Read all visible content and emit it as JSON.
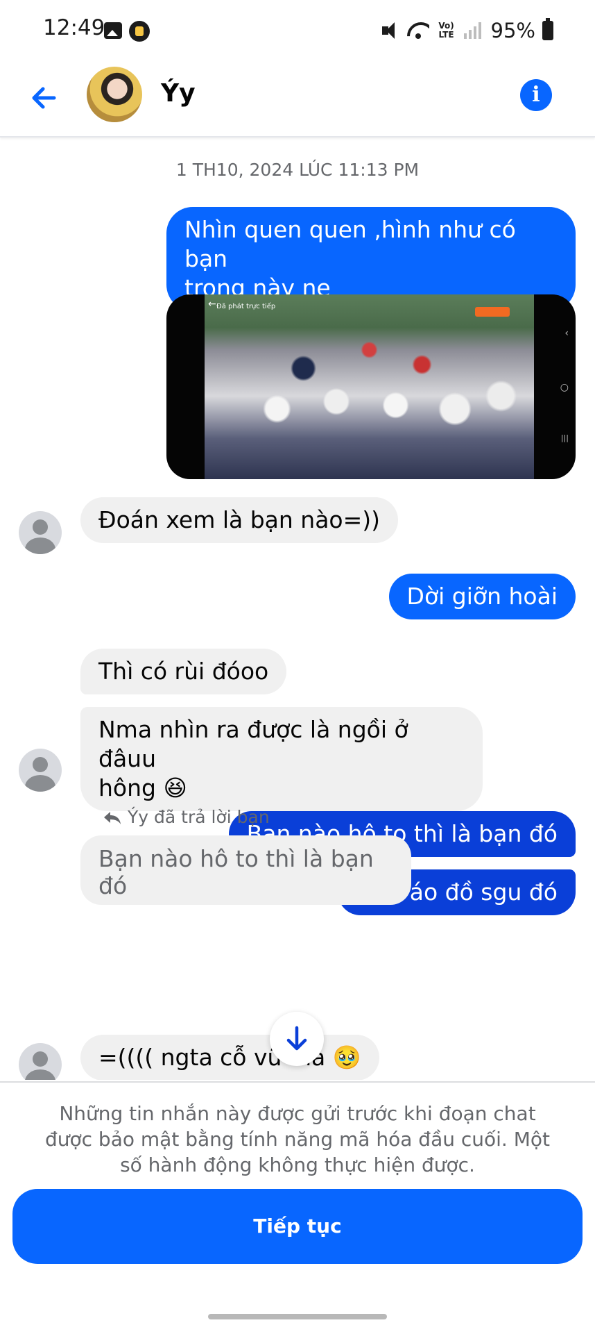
{
  "status_bar": {
    "time": "12:49",
    "network": "Vo) LTE",
    "battery": "95%",
    "icons": [
      "gallery-icon",
      "app-icon",
      "mute-icon",
      "wifi-icon",
      "signal-icon",
      "battery-icon"
    ]
  },
  "header": {
    "contact_name": "Ýy",
    "back_icon": "arrow-left-icon",
    "info_icon": "info-icon"
  },
  "chat": {
    "timestamp": "1 TH10, 2024 LÚC 11:13 PM",
    "photo": {
      "overlay_label": "Đã phát trực tiếp",
      "overlay_back": "←",
      "nav_chevron": "‹",
      "nav_home": "○",
      "nav_recent": "|||"
    },
    "messages": [
      {
        "sender": "me",
        "text_line1": "Nhìn quen quen ,hình như có bạn",
        "text_line2": "trong này ne"
      },
      {
        "sender": "them",
        "text": "Đoán xem là bạn nào=))"
      },
      {
        "sender": "me",
        "text": "Dời giỡn hoài"
      },
      {
        "sender": "them",
        "text": "Thì có rùi đóoo"
      },
      {
        "sender": "them",
        "text_line1": "Nma nhìn ra được là ngồi ở đâuu",
        "text_line2": "hông 😆"
      },
      {
        "sender": "me",
        "text": "Bạn nào hô to thì là bạn đó"
      },
      {
        "sender": "me",
        "text": "Mặc áo đồ sgu đó"
      },
      {
        "sender": "them",
        "text": "=(((( ngta cỗ vũ mà 🥹"
      }
    ],
    "reply": {
      "label": "Ýy đã trả lời bạn",
      "quoted_text": "Bạn nào hô to thì là bạn đó"
    }
  },
  "footer": {
    "notice": "Những tin nhắn này được gửi trước khi đoạn chat được bảo mật bằng tính năng mã hóa đầu cuối. Một số hành động không thực hiện được.",
    "continue_label": "Tiếp tục"
  },
  "colors": {
    "accent": "#0866ff",
    "outgoing_dark": "#0a3fd8",
    "incoming_bg": "#f0f0f0",
    "muted_text": "#65676b"
  }
}
